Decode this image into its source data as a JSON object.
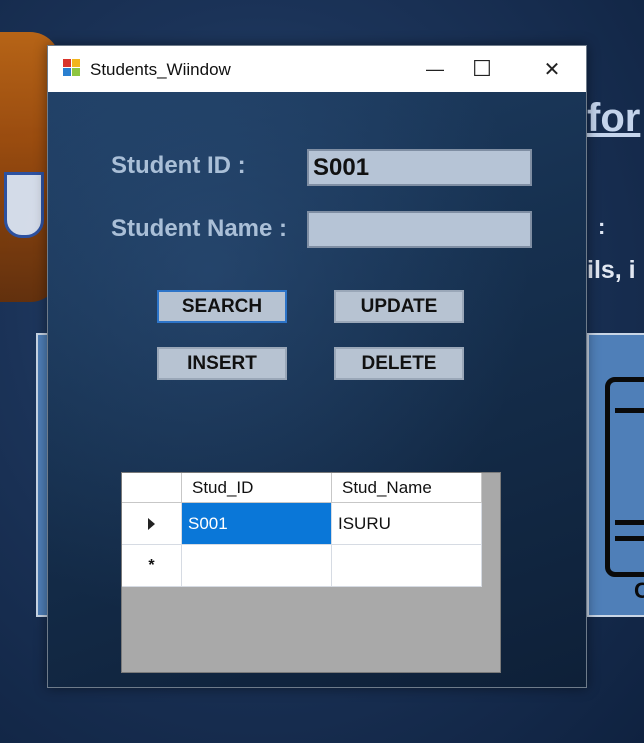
{
  "window": {
    "title": "Students_Wiindow",
    "minimize_glyph": "—",
    "maximize_glyph": "☐",
    "close_glyph": "✕"
  },
  "form": {
    "student_id_label": "Student ID  :",
    "student_id_value": "S001",
    "student_name_label": "Student Name :",
    "student_name_value": ""
  },
  "buttons": {
    "search": "SEARCH",
    "update": "UPDATE",
    "insert": "INSERT",
    "delete": "DELETE"
  },
  "grid": {
    "columns": [
      "Stud_ID",
      "Stud_Name"
    ],
    "rows": [
      {
        "indicator": "current",
        "stud_id": "S001",
        "stud_name": "ISURU"
      },
      {
        "indicator": "new",
        "stud_id": "",
        "stud_name": ""
      }
    ],
    "new_row_glyph": "*"
  },
  "background": {
    "title_fragment": "for",
    "colon_fragment": ":",
    "text_fragment": "ils, i",
    "device_letter": "C"
  },
  "colors": {
    "selection": "#0a77d8",
    "focus_border": "#2d74c8",
    "form_background": "#16304f",
    "label_text": "#aabfd7"
  }
}
